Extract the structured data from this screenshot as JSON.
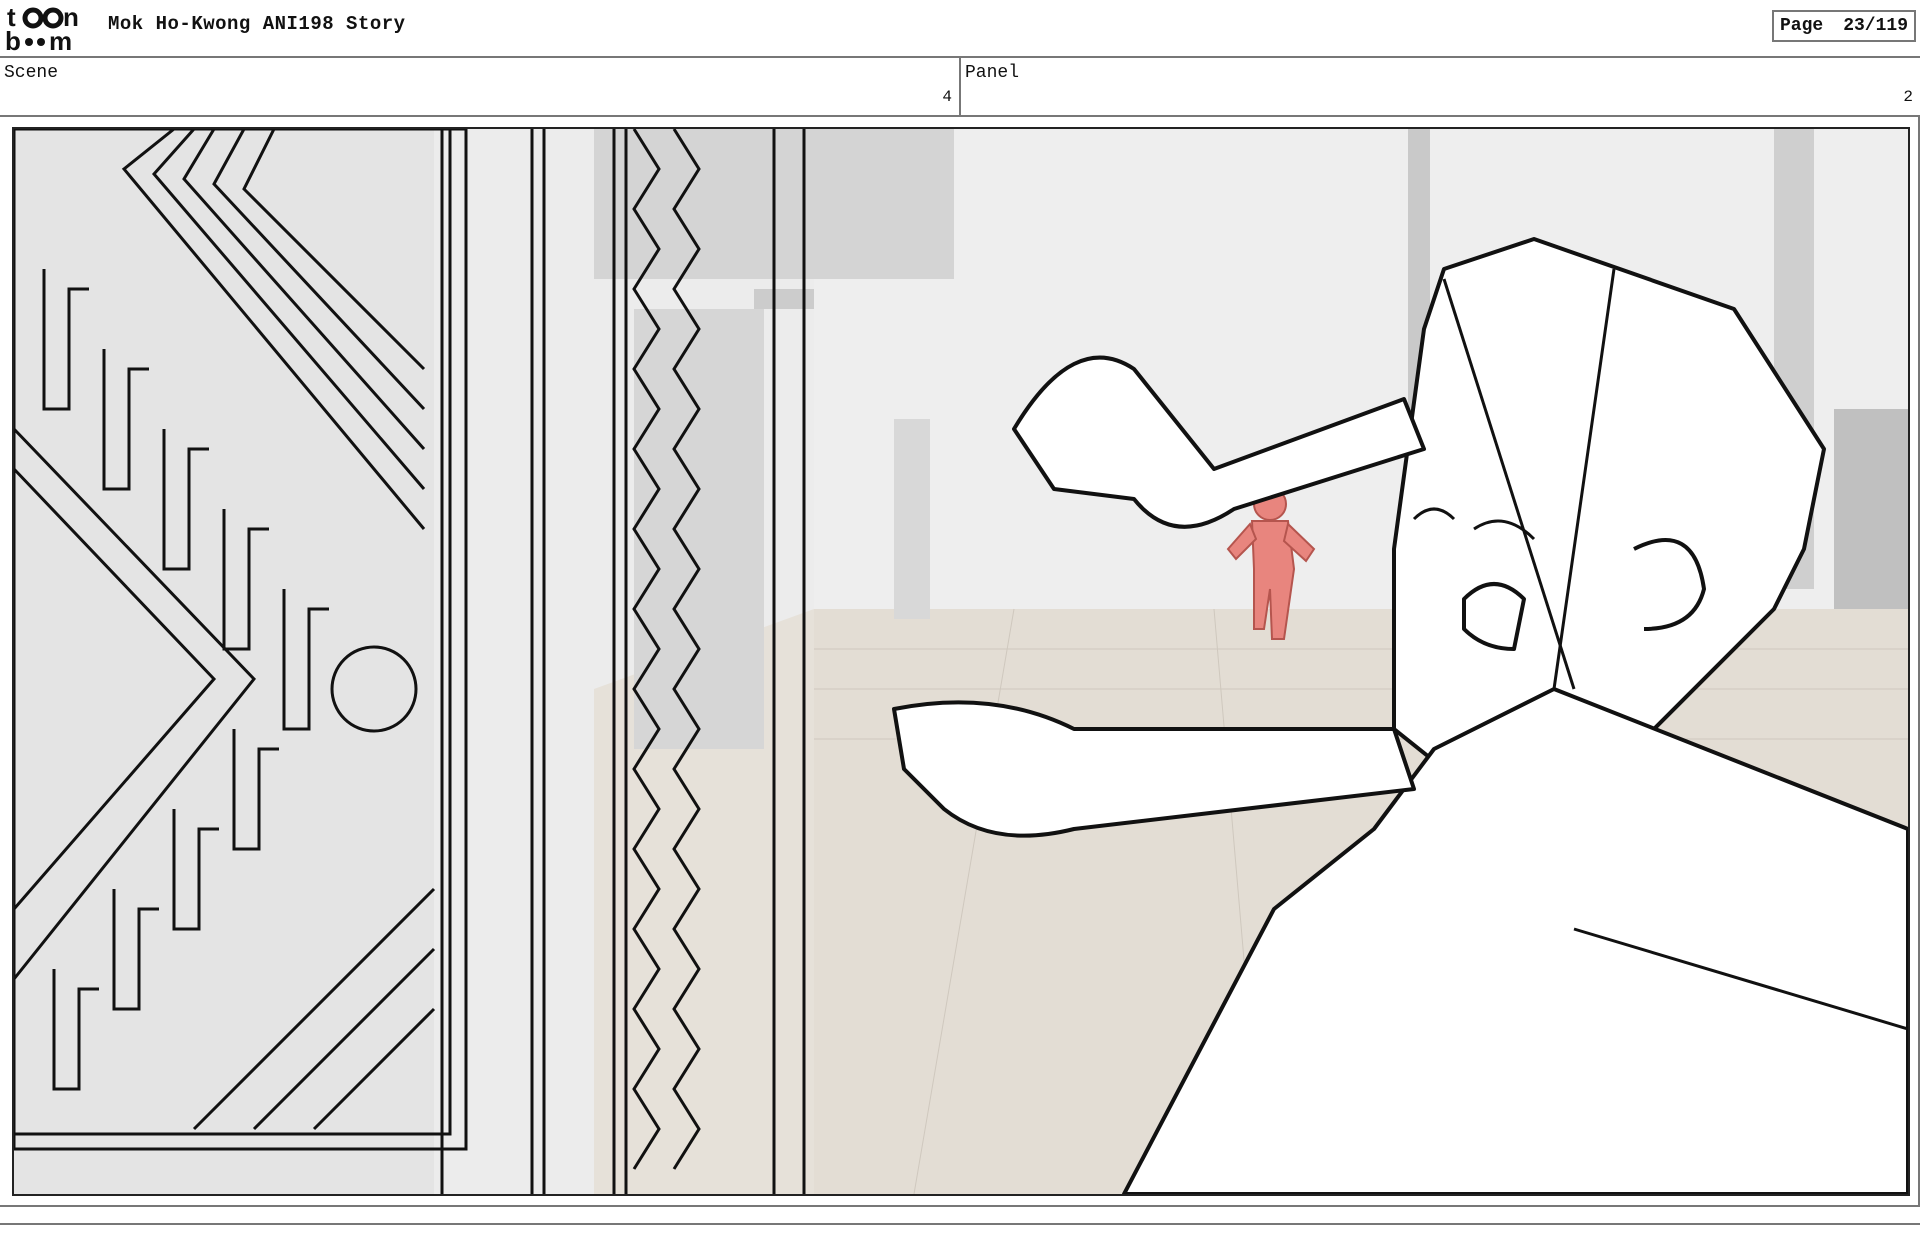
{
  "header": {
    "logo_text_top": "toon",
    "logo_text_bottom": "boom",
    "project_title": "Mok Ho-Kwong ANI198 Story",
    "page_label": "Page",
    "page_value": "23/119"
  },
  "fields": {
    "scene_label": "Scene",
    "scene_value": "4",
    "panel_label": "Panel",
    "panel_value": "2"
  },
  "colors": {
    "runner": "#e8857e",
    "floor": "#e3ddd4",
    "wall": "#e0e0e0",
    "pillar": "#c9c9c9"
  }
}
